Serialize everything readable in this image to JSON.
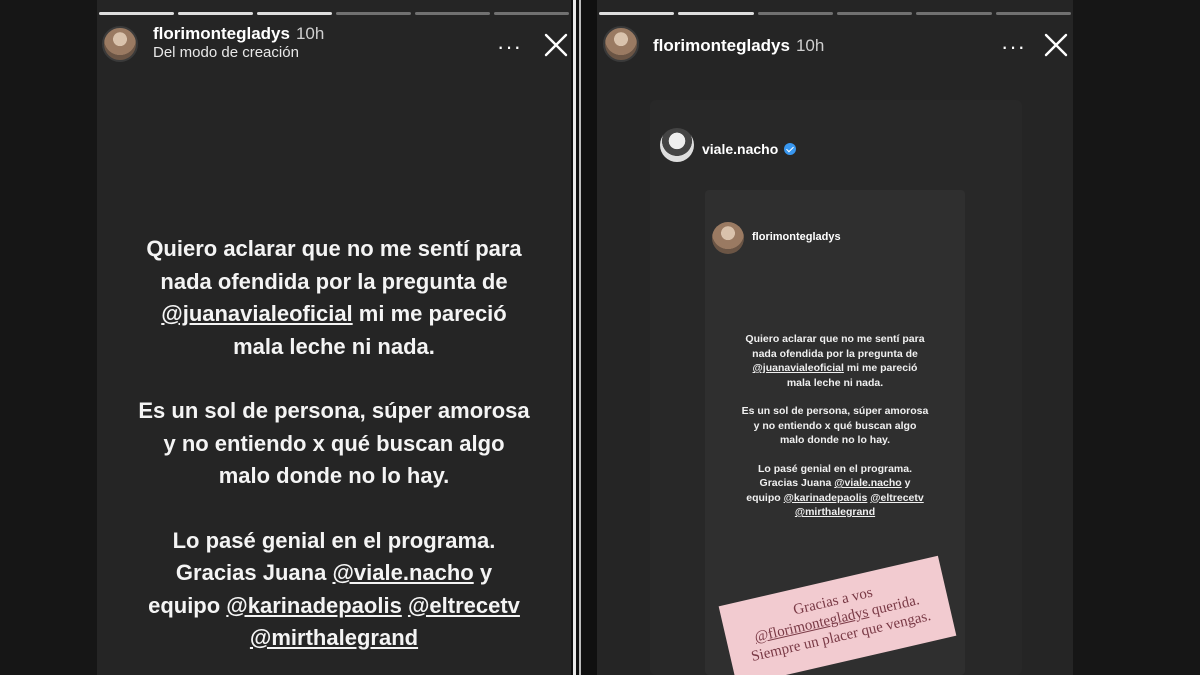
{
  "left_story": {
    "username": "florimontegladys",
    "time": "10h",
    "subtitle": "Del modo de creación",
    "more_label": "···",
    "paragraphs": [
      [
        "Quiero aclarar que no me sentí para\nnada ofendida por la pregunta de\n",
        "@juanavialeoficial",
        " mi me pareció\nmala leche ni nada."
      ],
      [
        "Es un sol de persona, súper amorosa\ny no entiendo x qué buscan algo\nmalo donde no lo hay."
      ],
      [
        "Lo pasé genial en el programa.\nGracias Juana  ",
        "@viale.nacho",
        " y\nequipo ",
        "@karinadepaolis",
        " ",
        "@eltrecetv",
        "\n",
        "@mirthalegrand",
        ""
      ]
    ]
  },
  "right_story": {
    "username": "florimontegladys",
    "time": "10h",
    "more_label": "···",
    "repost": {
      "username": "viale.nacho",
      "verified": true,
      "inner_username": "florimontegladys",
      "paragraphs": [
        [
          "Quiero aclarar que no me sentí para\nnada ofendida por la pregunta de\n",
          "@juanavialeoficial",
          " mi me pareció\nmala leche ni nada."
        ],
        [
          "Es un sol de persona, súper amorosa\ny no entiendo x qué buscan algo\nmalo donde no lo hay."
        ],
        [
          "Lo pasé genial en el programa.\nGracias Juana  ",
          "@viale.nacho",
          " y\nequipo ",
          "@karinadepaolis",
          " ",
          "@eltrecetv",
          "\n",
          "@mirthalegrand",
          ""
        ]
      ]
    },
    "sticker": {
      "line1": "Gracias a vos",
      "mention": "@florimontegladys",
      "line2_rest": " querida.",
      "line3": "Siempre un placer que vengas."
    }
  },
  "colors": {
    "background": "#161616",
    "story_bg": "#252525",
    "verified": "#3897f0",
    "sticker": "#f2cbd0"
  },
  "icons": [
    "more-options-icon",
    "close-icon",
    "verified-badge-icon"
  ]
}
